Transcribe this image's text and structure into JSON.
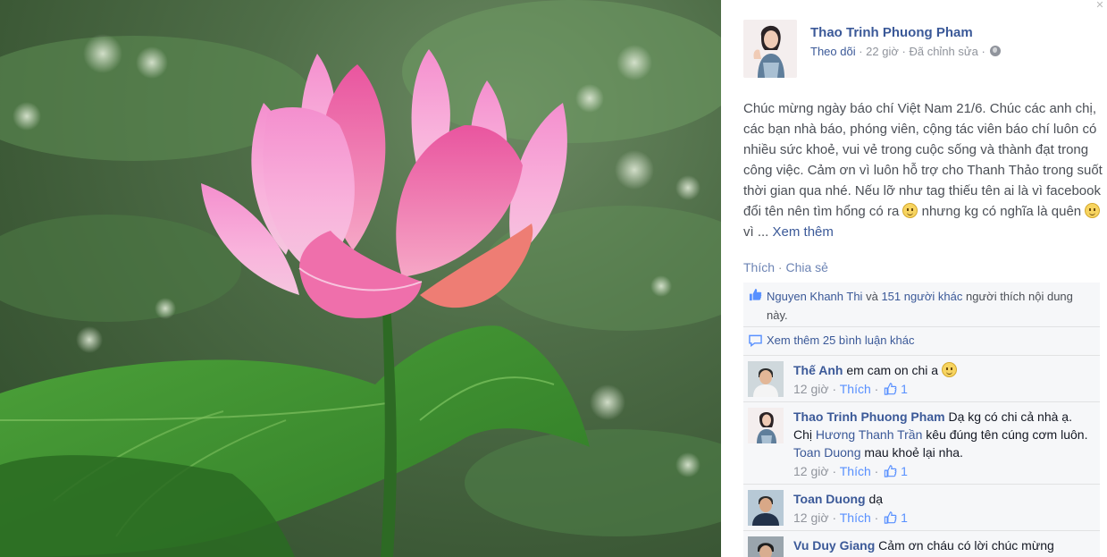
{
  "author": {
    "name": "Thao Trinh Phuong Pham",
    "follow_label": "Theo dõi",
    "time": "22 giờ",
    "edited": "Đã chỉnh sửa"
  },
  "post": {
    "text_part1": "Chúc mừng ngày báo chí Việt Nam 21/6. Chúc các anh chị, các bạn nhà báo, phóng viên, cộng tác viên báo chí luôn có nhiều sức khoẻ, vui vẻ trong cuộc sống và thành đạt trong công việc. Cảm ơn vì luôn hỗ trợ cho Thanh Thảo trong suốt thời gian qua nhé. Nếu lỡ như tag thiếu tên ai là vì facebook đổi tên nên tìm hổng có ra",
    "text_part2": "nhưng kg có nghĩa là quên",
    "text_part3": "vì ...",
    "see_more": "Xem thêm"
  },
  "actions": {
    "like": "Thích",
    "share": "Chia sẻ"
  },
  "likes": {
    "first_name": "Nguyen Khanh Thi",
    "and": "và",
    "others": "151 người khác",
    "suffix": "người thích nội dung này."
  },
  "more_comments": "Xem thêm 25 bình luận khác",
  "comments": [
    {
      "name": "Thế Anh",
      "text": "em cam on chi a",
      "time": "12 giờ",
      "like": "Thích",
      "likes": "1"
    },
    {
      "name": "Thao Trinh Phuong Pham",
      "text_a": "Dạ kg có chi cả nhà ạ. Chị",
      "mention1": "Hương Thanh Trần",
      "text_b": "kêu đúng tên cúng cơm luôn.",
      "mention2": "Toan Duong",
      "text_c": "mau khoẻ lại nha.",
      "time": "12 giờ",
      "like": "Thích",
      "likes": "1"
    },
    {
      "name": "Toan Duong",
      "text": "dạ",
      "time": "12 giờ",
      "like": "Thích",
      "likes": "1"
    },
    {
      "name": "Vu Duy Giang",
      "text": "Cảm ơn cháu có lời chúc mừng"
    }
  ],
  "colors": {
    "link": "#3b5998",
    "ufi_bg": "#f6f7f9",
    "meta": "#90949c"
  }
}
